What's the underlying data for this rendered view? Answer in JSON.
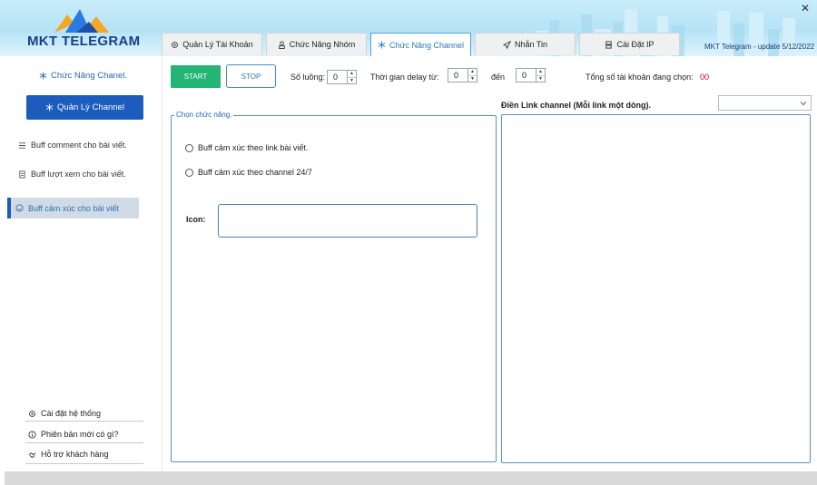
{
  "app": {
    "name": "MKT TELEGRAM",
    "version_text": "MKT Telegram - update 5/12/2022",
    "close_glyph": "✕"
  },
  "tabs": [
    {
      "label": "Quản Lý Tài Khoản",
      "icon": "gear-icon"
    },
    {
      "label": "Chức Năng Nhóm",
      "icon": "group-icon"
    },
    {
      "label": "Chức Năng Channel",
      "icon": "snowflake-icon",
      "active": true
    },
    {
      "label": "Nhắn Tin",
      "icon": "send-icon"
    },
    {
      "label": "Cài Đặt IP",
      "icon": "server-icon"
    }
  ],
  "sidebar": {
    "title": "Chức Năng Chanel.",
    "main_button": "Quản Lý Channel",
    "items": [
      {
        "label": "Buff comment cho bài viết.",
        "icon": "list-icon"
      },
      {
        "label": "Buff lượt xem cho bài viết.",
        "icon": "doc-icon"
      },
      {
        "label": "Buff cảm xúc cho bài viết",
        "icon": "smile-icon",
        "active": true
      }
    ],
    "bottom_links": [
      {
        "label": "Cài đặt hệ thống",
        "icon": "gear-icon"
      },
      {
        "label": "Phiên bản mới có gì?",
        "icon": "info-icon"
      },
      {
        "label": "Hỗ trợ khách hàng",
        "icon": "handshake-icon"
      }
    ]
  },
  "controls": {
    "start_label": "START",
    "stop_label": "STOP",
    "threads_label": "Số luồng:",
    "threads_value": "0",
    "delay_label": "Thời gian delay từ:",
    "delay_from": "0",
    "delay_to_label": "đến",
    "delay_to": "0",
    "total_label": "Tổng số tài khoản đang chọn:",
    "total_value": "00"
  },
  "function_panel": {
    "legend": "Chọn chức năng.",
    "options": [
      "Buff cảm xúc theo link bài viết.",
      "Buff cảm xúc theo channel 24/7"
    ],
    "icon_label": "Icon:",
    "icon_value": ""
  },
  "links_panel": {
    "label": "Điền Link channel (Mỗi link một dòng).",
    "value": "",
    "dropdown_value": ""
  },
  "colors": {
    "primary_blue": "#1b5cbd",
    "start_green": "#22b573",
    "count_red": "#d0021b",
    "accent": "#2a7ab8"
  }
}
